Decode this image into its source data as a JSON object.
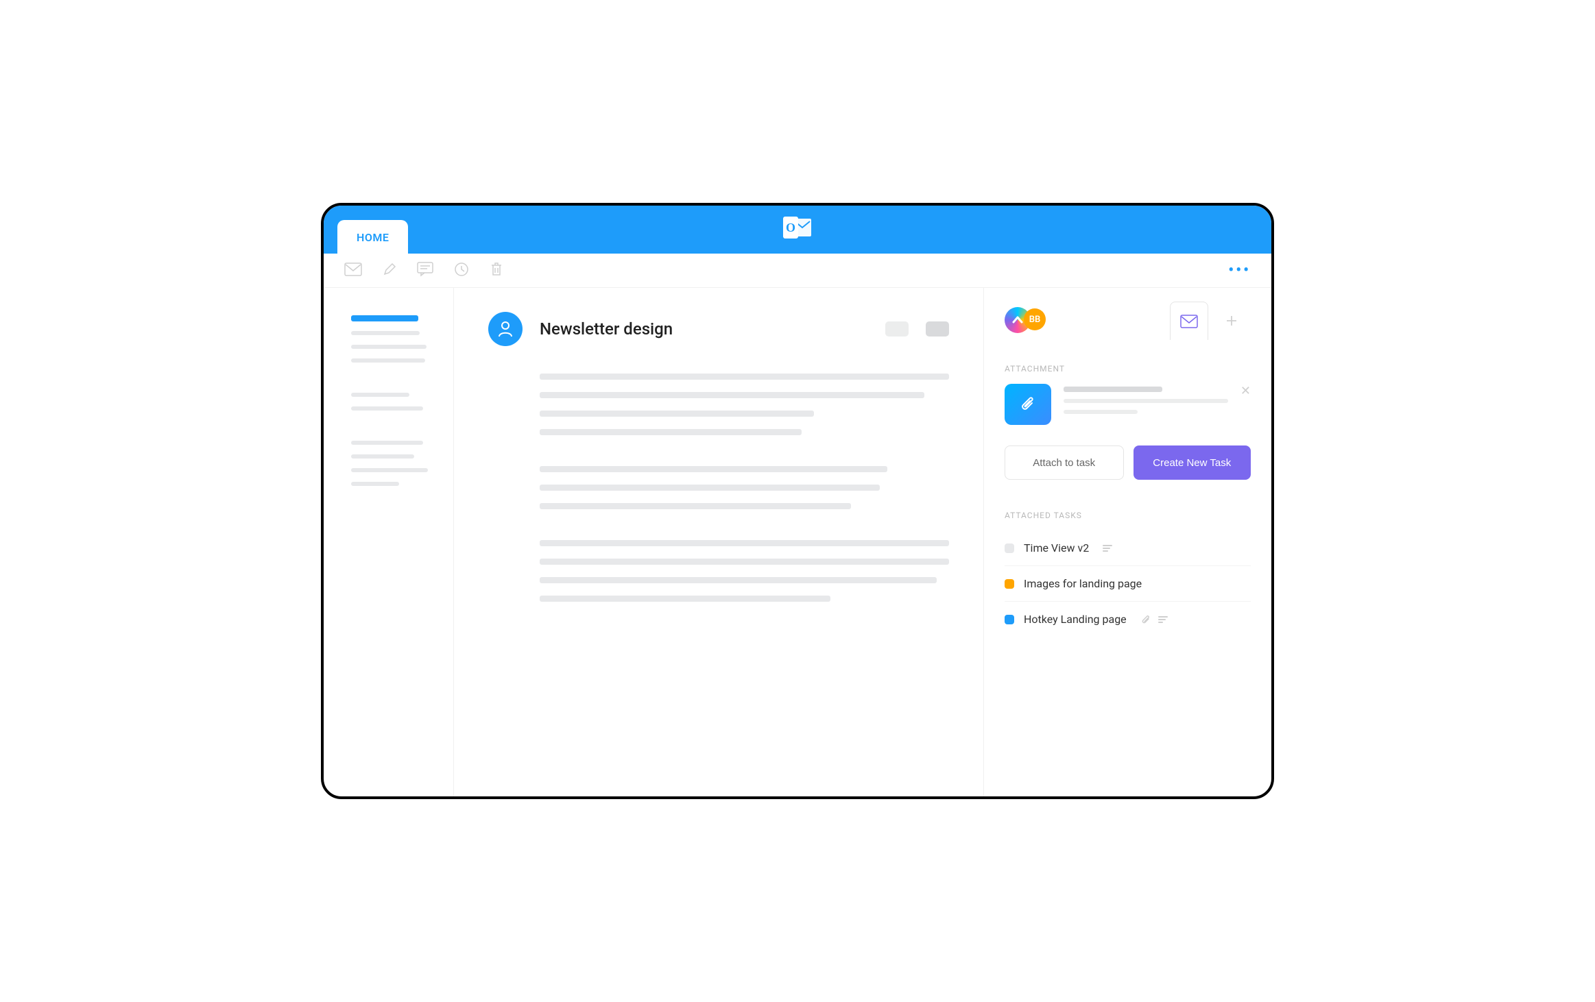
{
  "topbar": {
    "home_tab": "HOME"
  },
  "mail": {
    "subject": "Newsletter design"
  },
  "panel": {
    "badge": "BB",
    "attachment_label": "ATTACHMENT",
    "attach_to_task": "Attach to task",
    "create_new_task": "Create New Task",
    "attached_tasks_label": "ATTACHED TASKS",
    "tasks": [
      {
        "label": "Time View v2",
        "color": "gray",
        "has_lines": true,
        "has_clip": false
      },
      {
        "label": "Images for landing page",
        "color": "orange",
        "has_lines": false,
        "has_clip": false
      },
      {
        "label": "Hotkey Landing page",
        "color": "blue",
        "has_lines": true,
        "has_clip": true
      }
    ]
  }
}
